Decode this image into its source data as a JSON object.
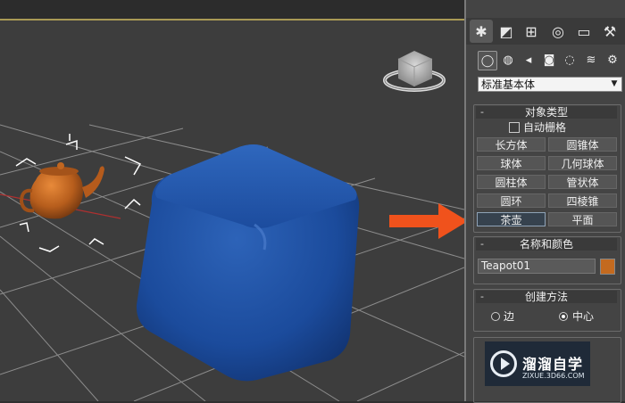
{
  "command_panel": {
    "main_tabs": [
      {
        "name": "create-tab",
        "icon": "✱",
        "active": true
      },
      {
        "name": "modify-tab",
        "icon": "◩",
        "active": false
      },
      {
        "name": "hierarchy-tab",
        "icon": "⊞",
        "active": false
      },
      {
        "name": "motion-tab",
        "icon": "◎",
        "active": false
      },
      {
        "name": "display-tab",
        "icon": "▭",
        "active": false
      },
      {
        "name": "utilities-tab",
        "icon": "⚒",
        "active": false
      }
    ],
    "sub_tabs": [
      {
        "name": "geometry",
        "icon": "◯",
        "active": true
      },
      {
        "name": "shapes",
        "icon": "◍",
        "active": false
      },
      {
        "name": "lights",
        "icon": "◂",
        "active": false
      },
      {
        "name": "cameras",
        "icon": "◙",
        "active": false
      },
      {
        "name": "helpers",
        "icon": "◌",
        "active": false
      },
      {
        "name": "space-warps",
        "icon": "≋",
        "active": false
      },
      {
        "name": "systems",
        "icon": "⚙",
        "active": false
      }
    ],
    "category_dropdown": "标准基本体",
    "object_type": {
      "header": "对象类型",
      "autogrid_label": "自动栅格",
      "buttons": [
        "长方体",
        "圆锥体",
        "球体",
        "几何球体",
        "圆柱体",
        "管状体",
        "圆环",
        "四棱锥",
        "茶壶",
        "平面"
      ],
      "active_button": "茶壶"
    },
    "name_and_color": {
      "header": "名称和颜色",
      "name_value": "Teapot01",
      "color": "#c46a1f"
    },
    "creation_method": {
      "header": "创建方法",
      "options": [
        "边",
        "中心"
      ],
      "selected": "中心"
    }
  },
  "watermark": {
    "brand": "溜溜自学",
    "url": "ZIXUE.3D66.COM"
  },
  "annotation_arrow_color": "#f0521c",
  "viewport": {
    "background": "#3d3d3d",
    "box_color": "#1d4fa0",
    "teapot_color": "#c2651f"
  }
}
